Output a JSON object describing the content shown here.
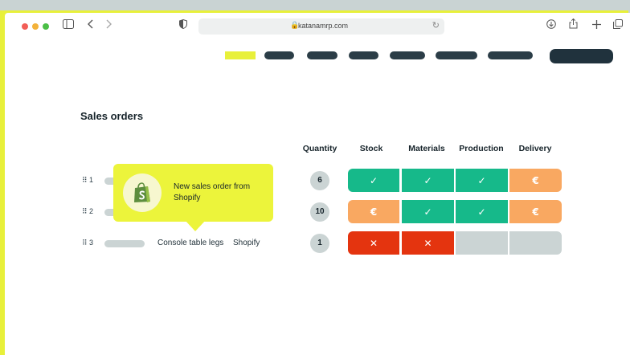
{
  "browser": {
    "url": "katanamrp.com"
  },
  "colors": {
    "ok": "#16b98a",
    "waiting": "#f9a861",
    "blocked": "#e4340f",
    "empty": "#cbd4d4",
    "accent": "#e8f03a",
    "dark": "#20323d"
  },
  "page": {
    "title": "Sales orders"
  },
  "table": {
    "columns": [
      "Quantity",
      "Stock",
      "Materials",
      "Production",
      "Delivery"
    ],
    "rows": [
      {
        "num": "1",
        "name": "",
        "channel": "",
        "quantity": "6",
        "cells": [
          "ok",
          "ok",
          "ok",
          "waiting"
        ]
      },
      {
        "num": "2",
        "name": "",
        "channel": "",
        "quantity": "10",
        "cells": [
          "waiting",
          "ok",
          "ok",
          "waiting"
        ]
      },
      {
        "num": "3",
        "name": "Console table legs",
        "channel": "Shopify",
        "quantity": "1",
        "cells": [
          "blocked",
          "blocked",
          "empty",
          "empty"
        ]
      }
    ]
  },
  "tooltip": {
    "message": "New sales order from Shopify",
    "icon": "shopify-bag-icon"
  },
  "status_icons": {
    "ok": "✓",
    "waiting": "€",
    "blocked": "✕",
    "empty": ""
  }
}
